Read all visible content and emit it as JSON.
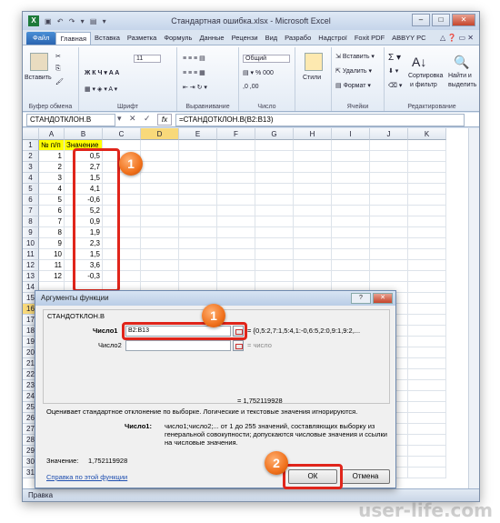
{
  "window": {
    "title": "Стандартная ошибка.xlsx - Microsoft Excel",
    "app_icon": "X",
    "min_label": "–",
    "max_label": "□",
    "close_label": "✕"
  },
  "tabs": {
    "file": "Файл",
    "items": [
      "Главная",
      "Вставка",
      "Разметка",
      "Формуль",
      "Данные",
      "Рецензи",
      "Вид",
      "Разрабо",
      "Надстрої",
      "Foxit PDF",
      "ABBYY PC"
    ]
  },
  "ribbon": {
    "paste": "Вставить",
    "clipboard_group": "Буфер обмена",
    "font_size": "11",
    "font_group": "Шрифт",
    "align_group": "Выравнивание",
    "number_format": "Общий",
    "number_group": "Число",
    "styles": "Стили",
    "insert": "Вставить",
    "delete": "Удалить",
    "format": "Формат",
    "cells_group": "Ячейки",
    "sort": "Сортировка",
    "sort2": "и фильтр",
    "find": "Найти и",
    "find2": "выделить",
    "edit_group": "Редактирование"
  },
  "formula_bar": {
    "name_box": "СТАНДОТКЛОН.В",
    "formula": "=СТАНДОТКЛОН.В(B2:B13)"
  },
  "columns": [
    "A",
    "B",
    "C",
    "D",
    "E",
    "F",
    "G",
    "H",
    "I",
    "J",
    "K"
  ],
  "rows": [
    "1",
    "2",
    "3",
    "4",
    "5",
    "6",
    "7",
    "8",
    "9",
    "10",
    "11",
    "12",
    "13",
    "14",
    "15",
    "16",
    "17",
    "18",
    "19",
    "20",
    "21",
    "22",
    "23",
    "24",
    "25",
    "26",
    "27",
    "28",
    "29",
    "30",
    "31"
  ],
  "table": {
    "header_a": "№ п/п",
    "header_b": "Значение",
    "a": [
      "1",
      "2",
      "3",
      "4",
      "5",
      "6",
      "7",
      "8",
      "9",
      "10",
      "11",
      "12"
    ],
    "b": [
      "0,5",
      "2,7",
      "1,5",
      "4,1",
      "-0,6",
      "5,2",
      "0,9",
      "1,9",
      "2,3",
      "1,5",
      "3,6",
      "-0,3"
    ]
  },
  "badges": {
    "b1": "1",
    "b2": "1",
    "b3": "2"
  },
  "dialog": {
    "title": "Аргументы функции",
    "help_btn": "?",
    "close_btn": "✕",
    "func_name": "СТАНДОТКЛОН.В",
    "arg1_label": "Число1",
    "arg1_value": "B2:B13",
    "arg1_result": "= {0,5:2,7:1,5:4,1:-0,6:5,2:0,9:1,9:2,...",
    "arg2_label": "Число2",
    "arg2_value": "",
    "arg2_result": "= число",
    "total": "= 1,752119928",
    "description": "Оценивает стандартное отклонение по выборке. Логические и текстовые значения игнорируются.",
    "param_name": "Число1:",
    "param_desc_1": "число1;число2;... от 1 до 255 значений, составляющих выборку из",
    "param_desc_2": "генеральной совокупности; допускаются числовые значения и ссылки",
    "param_desc_3": "на числовые значения.",
    "value_label": "Значение:",
    "value": "1,752119928",
    "help_link": "Справка по этой функции",
    "ok": "ОК",
    "cancel": "Отмена"
  },
  "status": {
    "mode": "Правка"
  },
  "watermark": "user-life.com",
  "colors": {
    "highlight": "#e0251b",
    "badge": "#f0711c",
    "header_fill": "#ffff00"
  }
}
